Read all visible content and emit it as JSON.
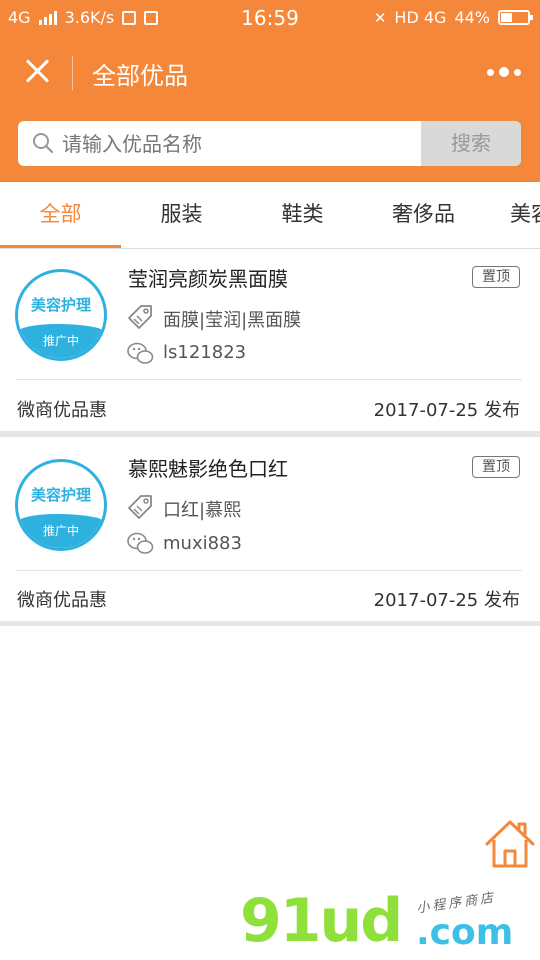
{
  "status_bar": {
    "network": "4G",
    "speed": "3.6K/s",
    "time": "16:59",
    "network_right": "HD 4G",
    "battery": "44%"
  },
  "header": {
    "title": "全部优品"
  },
  "search": {
    "placeholder": "请输入优品名称",
    "button_label": "搜索"
  },
  "tabs": [
    {
      "label": "全部",
      "active": true
    },
    {
      "label": "服装",
      "active": false
    },
    {
      "label": "鞋类",
      "active": false
    },
    {
      "label": "奢侈品",
      "active": false
    },
    {
      "label": "美容",
      "active": false
    }
  ],
  "items": [
    {
      "badge_top": "美容护理",
      "badge_bottom": "推广中",
      "title": "莹润亮颜炭黑面膜",
      "pin_label": "置顶",
      "tags": "面膜|莹润|黑面膜",
      "wechat": "ls121823",
      "shop": "微商优品惠",
      "date": "2017-07-25  发布"
    },
    {
      "badge_top": "美容护理",
      "badge_bottom": "推广中",
      "title": "慕熙魅影绝色口红",
      "pin_label": "置顶",
      "tags": "口红|慕熙",
      "wechat": "muxi883",
      "shop": "微商优品惠",
      "date": "2017-07-25  发布"
    }
  ],
  "watermark": {
    "main": "91ud",
    "com": ".com",
    "sub": "小程序商店"
  },
  "colors": {
    "accent": "#f5873a",
    "badge": "#2fb1e0"
  }
}
